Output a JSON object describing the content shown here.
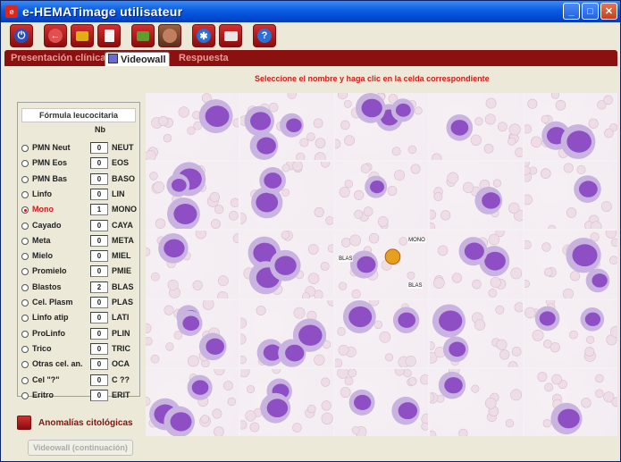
{
  "window": {
    "title": "e-HEMATimage utilisateur",
    "app_icon": "app-logo-icon",
    "controls": [
      "minimize-icon",
      "maximize-icon",
      "close-icon"
    ]
  },
  "toolbar": {
    "buttons": [
      {
        "name": "power-button",
        "icon": "power-icon"
      },
      {
        "name": "back-button",
        "icon": "arrow-left-icon"
      },
      {
        "name": "folder-red-button",
        "icon": "folder-icon"
      },
      {
        "name": "document-button",
        "icon": "document-icon"
      },
      {
        "name": "folder-open-button",
        "icon": "folder-open-icon"
      },
      {
        "name": "image-button",
        "icon": "image-icon"
      },
      {
        "name": "settings-button",
        "icon": "gear-icon"
      },
      {
        "name": "print-button",
        "icon": "printer-icon"
      },
      {
        "name": "help-button",
        "icon": "help-icon"
      }
    ]
  },
  "tabs": [
    {
      "label": "Presentación clínica",
      "active": false
    },
    {
      "label": "Videowall",
      "active": true
    },
    {
      "label": "Respuesta",
      "active": false
    }
  ],
  "instruction": "Seleccione el nombre y haga clic en la celda correspondiente",
  "formula": {
    "title": "Fórmula leucocitaria",
    "nb_header": "Nb",
    "rows": [
      {
        "label": "PMN Neut",
        "count": "0",
        "code": "NEUT",
        "selected": false
      },
      {
        "label": "PMN Eos",
        "count": "0",
        "code": "EOS",
        "selected": false
      },
      {
        "label": "PMN Bas",
        "count": "0",
        "code": "BASO",
        "selected": false
      },
      {
        "label": "Linfo",
        "count": "0",
        "code": "LIN",
        "selected": false
      },
      {
        "label": "Mono",
        "count": "1",
        "code": "MONO",
        "selected": true
      },
      {
        "label": "Cayado",
        "count": "0",
        "code": "CAYA",
        "selected": false
      },
      {
        "label": "Meta",
        "count": "0",
        "code": "META",
        "selected": false
      },
      {
        "label": "Mielo",
        "count": "0",
        "code": "MIEL",
        "selected": false
      },
      {
        "label": "Promielo",
        "count": "0",
        "code": "PMIE",
        "selected": false
      },
      {
        "label": "Blastos",
        "count": "2",
        "code": "BLAS",
        "selected": false
      },
      {
        "label": "Cel. Plasm",
        "count": "0",
        "code": "PLAS",
        "selected": false
      },
      {
        "label": "Linfo atip",
        "count": "0",
        "code": "LATI",
        "selected": false
      },
      {
        "label": "ProLinfo",
        "count": "0",
        "code": "PLIN",
        "selected": false
      },
      {
        "label": "Trico",
        "count": "0",
        "code": "TRIC",
        "selected": false
      },
      {
        "label": "Otras cel. an.",
        "count": "0",
        "code": "OCA",
        "selected": false
      },
      {
        "label": "Cel \"?\"",
        "count": "0",
        "code": "C ??",
        "selected": false
      },
      {
        "label": "Eritro",
        "count": "0",
        "code": "ERIT",
        "selected": false
      }
    ]
  },
  "anomalies_label": "Anomalías citológicas",
  "videowall_button": "Videowall (continuación)",
  "grid_tags": {
    "mono": "MONO",
    "blas_left": "BLAS",
    "blas_bottom": "BLAS"
  },
  "colors": {
    "accent_red": "#8b1010",
    "instruction_red": "#d41c1c",
    "cell_purple": "#8e4fc4"
  }
}
